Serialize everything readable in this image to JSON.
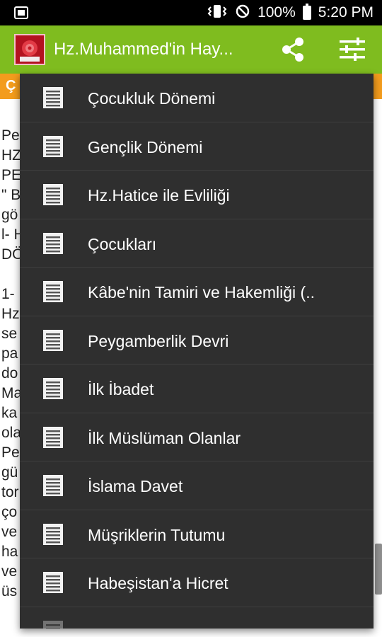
{
  "status_bar": {
    "battery_percent": "100%",
    "time": "5:20 PM"
  },
  "app_bar": {
    "title": "Hz.Muhammed'in Hay..."
  },
  "background": {
    "strip_text": "Ç",
    "lines": [
      "Pe",
      "HZ",
      "PE",
      "\" B",
      "gö",
      "l- H",
      "DÖ",
      "",
      "1-",
      "Hz",
      "se",
      "pa",
      "do",
      "Ma",
      "ka",
      "ola",
      "Pe",
      "gü",
      "tor",
      "ço",
      "ve",
      "ha",
      "ve",
      "üs"
    ]
  },
  "menu": {
    "items": [
      {
        "label": "Çocukluk Dönemi"
      },
      {
        "label": "Gençlik Dönemi"
      },
      {
        "label": "Hz.Hatice ile Evliliği"
      },
      {
        "label": "Çocukları"
      },
      {
        "label": "Kâbe'nin Tamiri ve Hakemliği (.."
      },
      {
        "label": "Peygamberlik Devri"
      },
      {
        "label": "İlk İbadet"
      },
      {
        "label": "İlk Müslüman Olanlar"
      },
      {
        "label": "İslama Davet"
      },
      {
        "label": "Müşriklerin Tutumu"
      },
      {
        "label": "Habeşistan'a Hicret"
      },
      {
        "label": ""
      }
    ]
  },
  "icons": {
    "menu_item_icon": "document-icon",
    "share": "share-icon",
    "settings": "settings-sliders-icon"
  }
}
